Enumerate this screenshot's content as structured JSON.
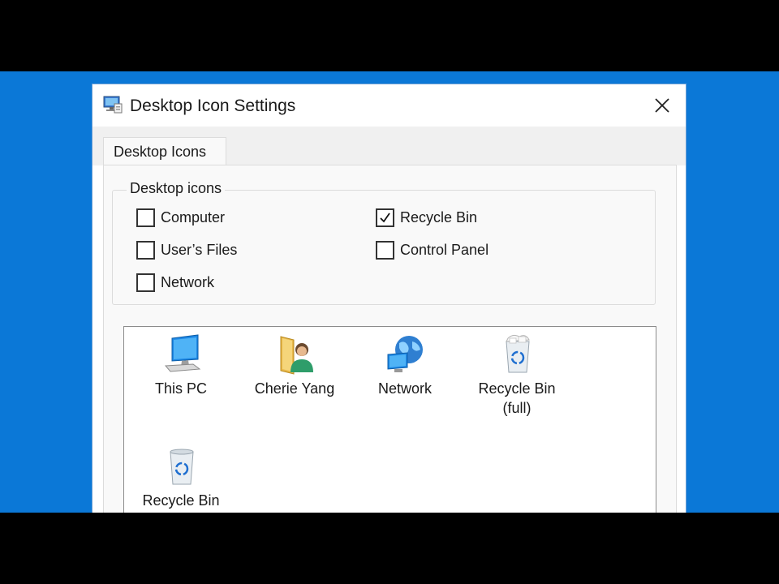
{
  "dialog": {
    "title": "Desktop Icon Settings",
    "title_icon": "monitor-settings-icon",
    "close_icon": "close-icon"
  },
  "tabs": [
    {
      "label": "Desktop Icons",
      "selected": true
    }
  ],
  "desktop_icons_group": {
    "label": "Desktop icons",
    "checkboxes": [
      {
        "label": "Computer",
        "checked": false
      },
      {
        "label": "Recycle Bin",
        "checked": true
      },
      {
        "label": "User’s Files",
        "checked": false
      },
      {
        "label": "Control Panel",
        "checked": false
      },
      {
        "label": "Network",
        "checked": false
      }
    ]
  },
  "icon_list": [
    {
      "label": "This PC",
      "icon": "this-pc-icon"
    },
    {
      "label": "Cherie Yang",
      "icon": "user-folder-icon"
    },
    {
      "label": "Network",
      "icon": "network-icon"
    },
    {
      "label": "Recycle Bin\n(full)",
      "icon": "recycle-bin-full-icon"
    },
    {
      "label": "Recycle Bin",
      "icon": "recycle-bin-empty-icon"
    }
  ],
  "colors": {
    "desktop_blue": "#0b78d7",
    "dialog_border": "#6d9fd4",
    "tab_strip": "#f0f0f0",
    "panel": "#f9f9f9"
  }
}
